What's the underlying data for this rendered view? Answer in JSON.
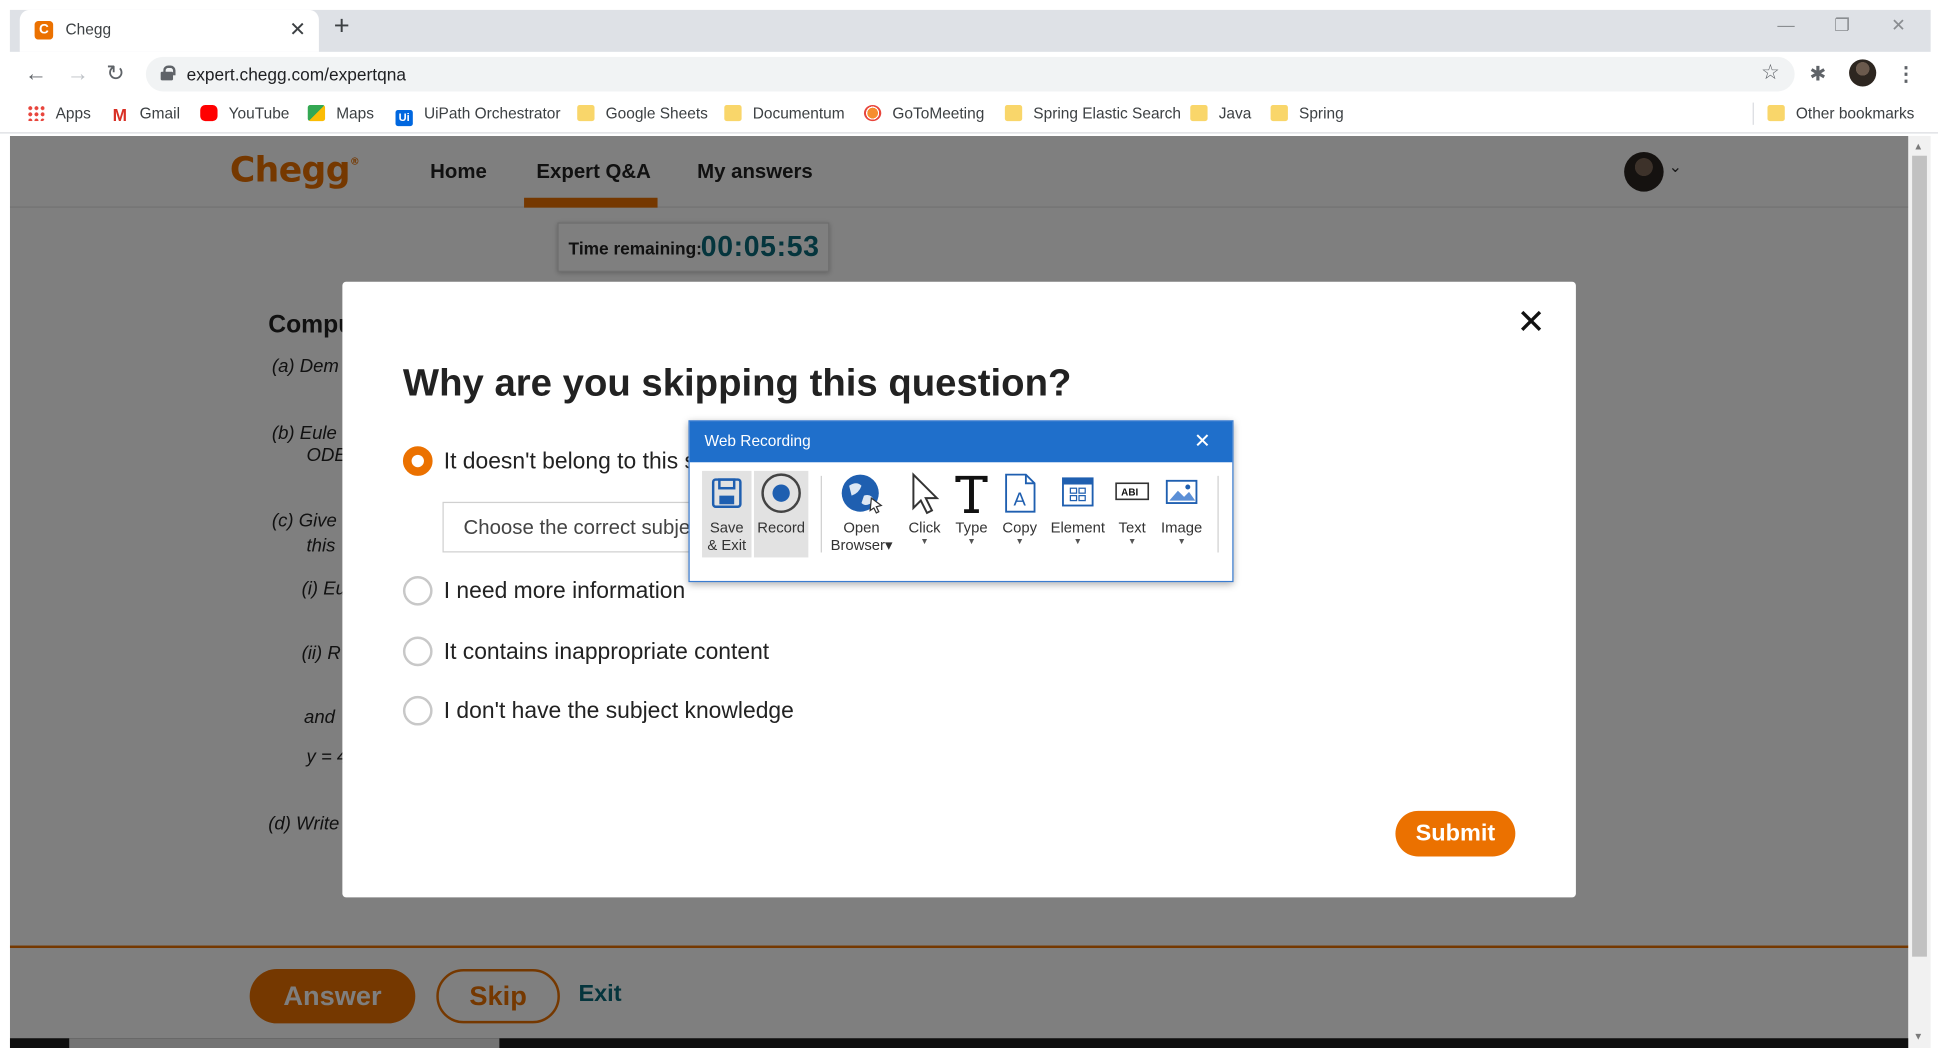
{
  "browser": {
    "tab_title": "Chegg",
    "tab_favicon": "C",
    "url": "expert.chegg.com/expertqna",
    "bookmarks": [
      {
        "label": "Apps",
        "icon": "apps-icon"
      },
      {
        "label": "Gmail",
        "icon": "gmail-icon"
      },
      {
        "label": "YouTube",
        "icon": "youtube-icon"
      },
      {
        "label": "Maps",
        "icon": "maps-icon"
      },
      {
        "label": "UiPath Orchestrator",
        "icon": "uipath-icon"
      },
      {
        "label": "Google Sheets",
        "icon": "folder-icon"
      },
      {
        "label": "Documentum",
        "icon": "folder-icon"
      },
      {
        "label": "GoToMeeting",
        "icon": "gotomeeting-icon"
      },
      {
        "label": "Spring Elastic Search",
        "icon": "folder-icon"
      },
      {
        "label": "Java",
        "icon": "folder-icon"
      },
      {
        "label": "Spring",
        "icon": "folder-icon"
      }
    ],
    "other_bookmarks": "Other bookmarks"
  },
  "site": {
    "logo": "Chegg",
    "nav": {
      "home": "Home",
      "expert_qa": "Expert Q&A",
      "my_answers": "My answers"
    },
    "timer_label": "Time remaining:",
    "timer_value": "00:05:53",
    "accent_color": "#eb7100",
    "teal_color": "#0a6b7a"
  },
  "question_bg": {
    "title": "Compu",
    "lines": [
      "(a) Dem",
      "(b) Eule",
      "ODE",
      "(c) Give",
      "this",
      "(i) Eu",
      "(ii) R",
      "and",
      "y = 4",
      "(d) Write"
    ]
  },
  "bottom": {
    "answer": "Answer",
    "skip": "Skip",
    "exit": "Exit"
  },
  "modal": {
    "heading": "Why are you skipping this question?",
    "options": [
      {
        "label": "It doesn't belong to this subject",
        "selected": true
      },
      {
        "label": "I need more information",
        "selected": false
      },
      {
        "label": "It contains inappropriate content",
        "selected": false
      },
      {
        "label": "I don't have the subject knowledge",
        "selected": false
      }
    ],
    "subject_placeholder": "Choose the correct subject",
    "submit": "Submit"
  },
  "web_recording": {
    "title": "Web Recording",
    "items": {
      "save_exit_1": "Save",
      "save_exit_2": "& Exit",
      "record": "Record",
      "open_browser_1": "Open",
      "open_browser_2": "Browser",
      "click": "Click",
      "type": "Type",
      "copy": "Copy",
      "element": "Element",
      "text": "Text",
      "image": "Image"
    }
  }
}
